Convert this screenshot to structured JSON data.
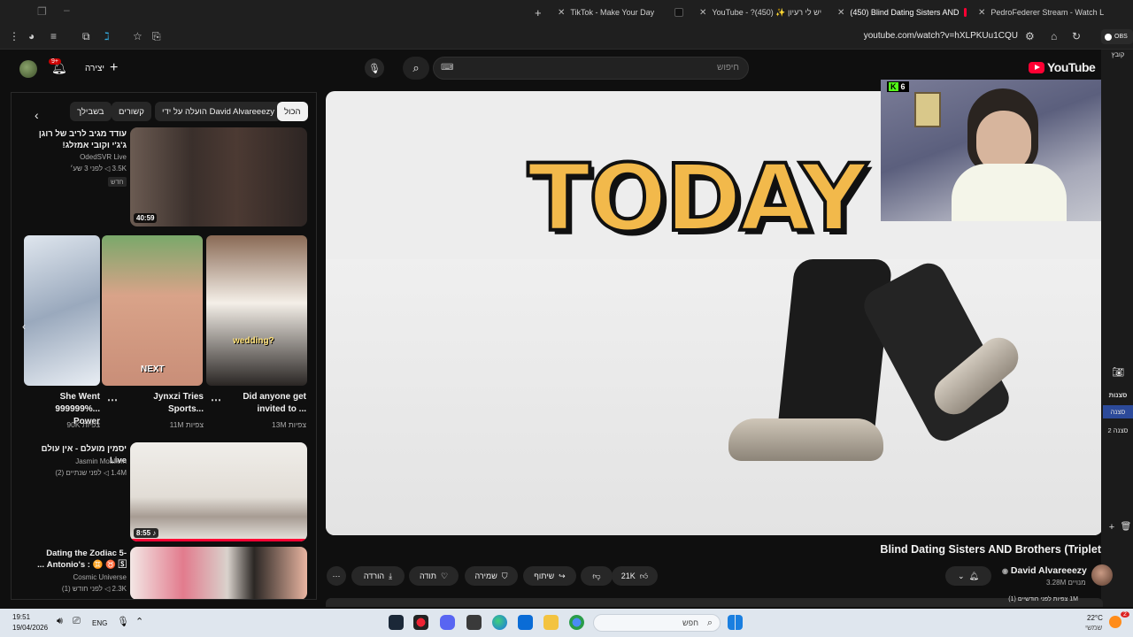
{
  "browser": {
    "tabs": [
      {
        "label": "PedroFederer Stream - Watch L",
        "active": false
      },
      {
        "label": "(450) Blind Dating Sisters AND",
        "active": true
      },
      {
        "label": "YouTube - ?יש לי רעיון ✨ (450)",
        "active": false
      },
      {
        "label": "TikTok - Make Your Day",
        "active": false
      }
    ],
    "url": "youtube.com/watch?v=hXLPKUu1CQU",
    "new_tab": "+"
  },
  "header": {
    "logo_text": "YouTube",
    "search_placeholder": "חיפוש",
    "create_label": "יצירה",
    "notification_count": "9+"
  },
  "sidebar": {
    "chips": [
      "הכול",
      "הועלה על ידי David Alvareeezy",
      "קשורים",
      "בשבילך"
    ],
    "videos": [
      {
        "title": "עודד מגיב לריב של רוגן ג'ג'י וקובי אמזלג!",
        "channel": "OdedSVR Live",
        "meta": "3.5K ◁ לפני 3 שע׳",
        "badge": "חדש",
        "duration": "40:59"
      },
      {
        "title": "יסמין מועלם - אין עולם Live",
        "channel": "Jasmin Moallem",
        "meta": "1.4M ◁ לפני שנתיים (2)",
        "duration": "8:55 ♪"
      },
      {
        "title": "Dating the Zodiac 5- Antonio's : ♊ ♉ 🅂 ...",
        "channel": "Cosmic Universe",
        "meta": "2.3K ◁ לפני חודש (1)"
      }
    ],
    "shorts": [
      {
        "title": "Did anyone get invited to ...",
        "views": "13M צפיות",
        "overlay": "wedding?"
      },
      {
        "title": "Jynxzi Tries Sports...",
        "views": "11M צפיות",
        "overlay": "NEXT"
      },
      {
        "title": "She Went 999999%... Power",
        "views": "90K צפיות",
        "overlay": ""
      }
    ]
  },
  "player": {
    "big_text": "TODAY"
  },
  "webcam": {
    "kick_count": "6"
  },
  "obs": {
    "tab_label": "OBS",
    "items": [
      "קובץ",
      "סצנות",
      "סצנה",
      "סצנה 2"
    ]
  },
  "video": {
    "title": "Blind Dating Sisters AND Brothers (Triplet",
    "channel": "David Alvareeezy",
    "subscribers": "3.28M מנויים",
    "likes": "21K",
    "share": "שיתוף",
    "save": "שמירה",
    "thanks": "תודה",
    "download": "הורדה",
    "below": "1M צפיות  לפני חודשיים (1)"
  },
  "taskbar": {
    "time": "19:51",
    "date": "19/04/2026",
    "lang": "ENG",
    "search_label": "חפש",
    "weather_temp": "22°C",
    "weather_desc": "שמשי",
    "notif_count": "2"
  },
  "colors": {
    "yt_red": "#ff0033",
    "kick_green": "#53fc18",
    "today_yellow": "#f2b94b"
  }
}
